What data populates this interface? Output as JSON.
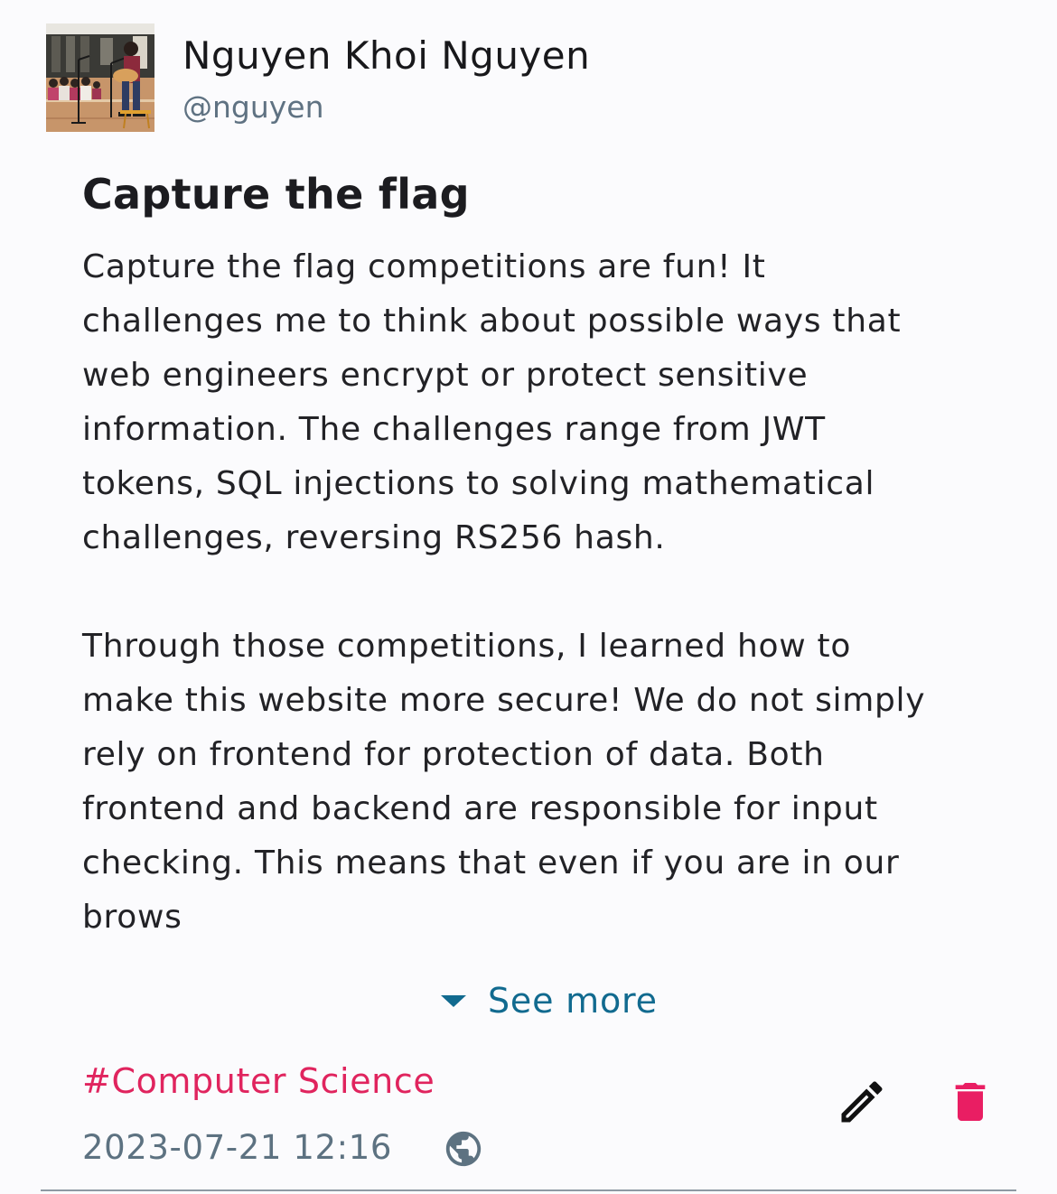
{
  "author": {
    "name": "Nguyen Khoi Nguyen",
    "handle": "@nguyen"
  },
  "post": {
    "title": "Capture the flag",
    "body_lines": [
      "Capture the flag competitions are fun! It",
      "challenges me to think about possible ways that",
      "web engineers encrypt or protect sensitive",
      "information. The challenges range from JWT",
      "tokens, SQL injections to solving mathematical",
      "challenges, reversing RS256 hash.",
      "",
      "Through those competitions, I learned how to",
      "make this website more secure! We do not simply",
      "rely on frontend for protection of data. Both",
      "frontend and backend are responsible for input",
      "checking. This means that even if you are in our",
      "brows"
    ],
    "see_more_label": "See more",
    "hashtag": "#Computer Science",
    "timestamp": "2023-07-21 12:16",
    "visibility_icon": "globe-icon"
  },
  "actions": {
    "edit_icon": "pencil-icon",
    "delete_icon": "trash-icon"
  },
  "colors": {
    "background": "#fbfbfd",
    "link": "#116a8f",
    "hashtag": "#e0245e",
    "delete": "#e91e63",
    "muted": "#5d7281"
  }
}
